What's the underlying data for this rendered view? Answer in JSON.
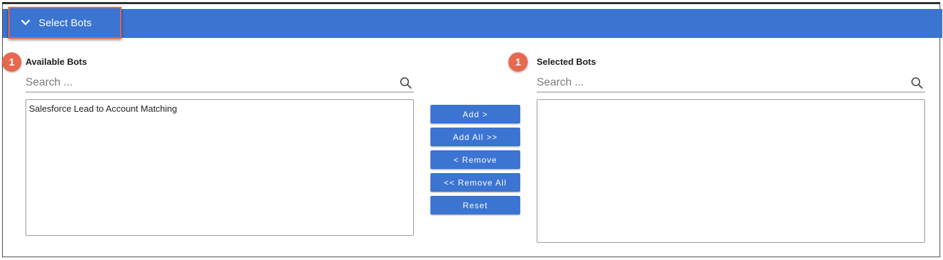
{
  "header": {
    "title": "Select Bots",
    "expanded": true
  },
  "available": {
    "badge": "1",
    "label": "Available Bots",
    "search_placeholder": "Search ...",
    "items": [
      "Salesforce Lead to Account Matching"
    ]
  },
  "selected": {
    "badge": "1",
    "label": "Selected Bots",
    "search_placeholder": "Search ...",
    "items": []
  },
  "actions": {
    "add": "Add >",
    "add_all": "Add All >>",
    "remove": "< Remove",
    "remove_all": "<< Remove All",
    "reset": "Reset"
  },
  "colors": {
    "accent": "#3b74d1",
    "badge": "#e8684f",
    "highlight_border": "#e2654c"
  },
  "icons": {
    "toggle": "chevron-down-icon",
    "search": "search-icon"
  }
}
